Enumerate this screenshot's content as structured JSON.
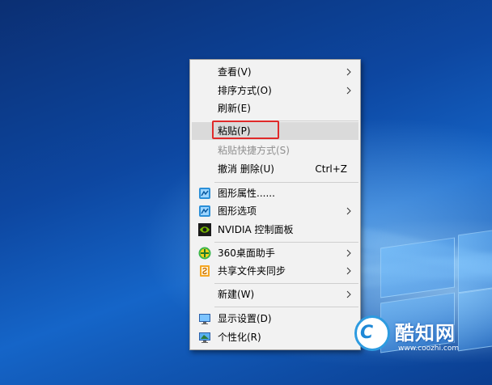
{
  "context_menu": {
    "items": [
      {
        "label": "查看(V)"
      },
      {
        "label": "排序方式(O)"
      },
      {
        "label": "刷新(E)"
      },
      {
        "label": "粘贴(P)"
      },
      {
        "label": "粘贴快捷方式(S)"
      },
      {
        "label": "撤消 删除(U)",
        "shortcut": "Ctrl+Z"
      },
      {
        "label": "图形属性......",
        "icon": "intel-graphics-icon"
      },
      {
        "label": "图形选项",
        "icon": "intel-graphics-icon"
      },
      {
        "label": "NVIDIA 控制面板",
        "icon": "nvidia-icon"
      },
      {
        "label": "360桌面助手",
        "icon": "360-icon"
      },
      {
        "label": "共享文件夹同步",
        "icon": "share-sync-icon"
      },
      {
        "label": "新建(W)"
      },
      {
        "label": "显示设置(D)",
        "icon": "display-icon"
      },
      {
        "label": "个性化(R)",
        "icon": "personalize-icon"
      }
    ],
    "highlighted_item": "粘贴(P)",
    "disabled_item": "粘贴快捷方式(S)"
  },
  "watermark": {
    "title": "酷知网",
    "url": "www.coozhi.com",
    "logo_text": "C"
  },
  "colors": {
    "highlight_box": "#e02a2a",
    "menu_bg": "#f2f2f2"
  }
}
